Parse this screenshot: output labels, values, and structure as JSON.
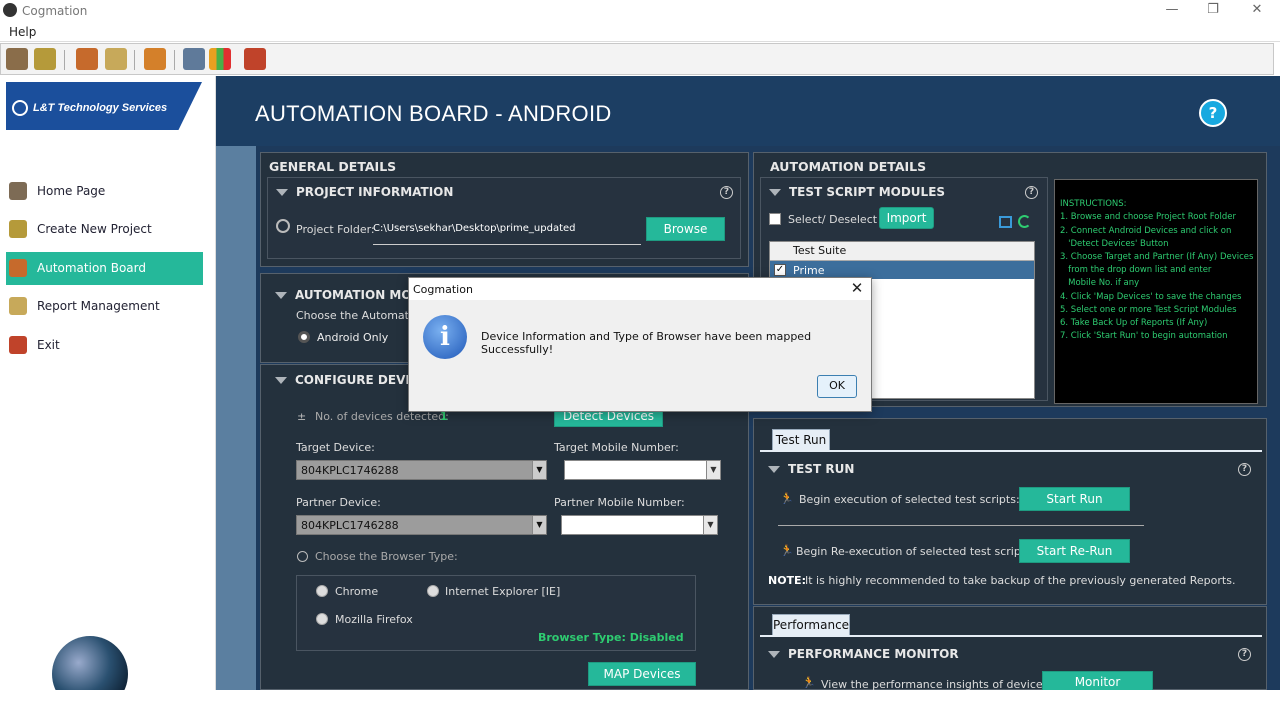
{
  "window": {
    "title": "Cogmation",
    "minimize": "—",
    "restore": "❐",
    "close": "✕"
  },
  "menu": {
    "help": "Help"
  },
  "sidebar": {
    "logo_text": "L&T Technology Services",
    "items": [
      {
        "label": "Home Page",
        "icon": "home-icon"
      },
      {
        "label": "Create New Project",
        "icon": "new-project-icon"
      },
      {
        "label": "Automation Board",
        "icon": "automation-icon",
        "active": true
      },
      {
        "label": "Report Management",
        "icon": "report-icon"
      },
      {
        "label": "Exit",
        "icon": "exit-icon"
      }
    ]
  },
  "header": {
    "title": "AUTOMATION BOARD - ANDROID",
    "help": "?"
  },
  "general": {
    "title": "GENERAL DETAILS",
    "project": {
      "title": "PROJECT INFORMATION",
      "folder_label": "Project Folder:",
      "folder_value": "C:\\Users\\sekhar\\Desktop\\prime_updated",
      "browse": "Browse"
    },
    "mode": {
      "title": "AUTOMATION MODE",
      "prompt": "Choose the Automation",
      "option": "Android Only"
    },
    "devices": {
      "title": "CONFIGURE DEVICES/",
      "detected_label": "No. of devices detected:",
      "detected_count": "1",
      "detect_button": "Detect Devices",
      "target_label": "Target Device:",
      "target_value": "804KPLC1746288",
      "target_mobile_label": "Target Mobile Number:",
      "partner_label": "Partner Device:",
      "partner_value": "804KPLC1746288",
      "partner_mobile_label": "Partner Mobile Number:",
      "browser_prompt": "Choose the Browser Type:",
      "browsers": [
        "Chrome",
        "Internet Explorer [IE]",
        "Mozilla Firefox"
      ],
      "browser_status": "Browser Type:  Disabled",
      "map_button": "MAP Devices"
    }
  },
  "automation": {
    "title": "AUTOMATION DETAILS",
    "modules": {
      "title": "TEST SCRIPT MODULES",
      "select_label": "Select/ Deselect",
      "import": "Import",
      "column": "Test Suite",
      "rows": [
        "Prime"
      ]
    },
    "instructions": [
      "INSTRUCTIONS:",
      "1. Browse and choose Project Root Folder",
      "2. Connect Android Devices and click on",
      "   'Detect Devices' Button",
      "3. Choose Target and Partner (If Any) Devices",
      "   from the drop down list and enter",
      "   Mobile No. if any",
      "4. Click 'Map Devices' to save the changes",
      "5. Select one or more Test Script Modules",
      "6. Take Back Up of Reports (If Any)",
      "7. Click 'Start Run' to begin automation"
    ],
    "testrun": {
      "tab": "Test Run",
      "title": "TEST RUN",
      "begin_label": "Begin execution of selected test scripts:",
      "start": "Start Run",
      "rerun_label": "Begin Re-execution of selected test scripts:",
      "restart": "Start Re-Run",
      "note_key": "NOTE:",
      "note": "It is highly recommended to take backup of the previously generated Reports."
    },
    "performance": {
      "tab": "Performance",
      "title": "PERFORMANCE MONITOR",
      "label": "View the performance insights of device",
      "button": "Monitor"
    }
  },
  "dialog": {
    "title": "Cogmation",
    "message": "Device Information and Type of Browser have been mapped Successfully!",
    "ok": "OK",
    "icon": "info-icon",
    "close": "✕"
  },
  "colors": {
    "accent": "#25b89a",
    "navy": "#1c3e63",
    "panel": "#24313d",
    "instructions_text": "#2ecc71"
  }
}
